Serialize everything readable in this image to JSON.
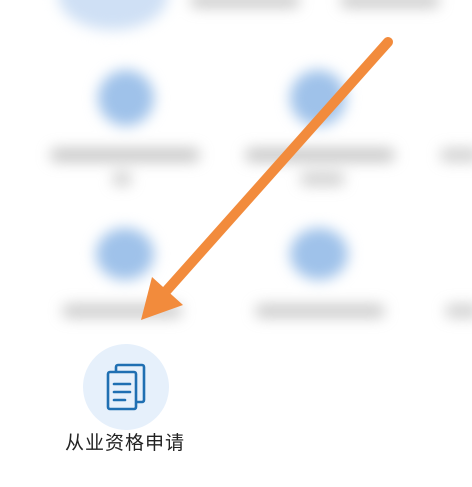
{
  "app_tile": {
    "label": "从业资格申请",
    "icon": "document-copy-icon"
  },
  "annotation": {
    "icon": "arrow-pointer-icon",
    "color": "#f28b3c"
  },
  "colors": {
    "icon_bg": "#e6f0fb",
    "icon_stroke": "#1f6fb2",
    "blur_tile": "#9fc2ea"
  }
}
